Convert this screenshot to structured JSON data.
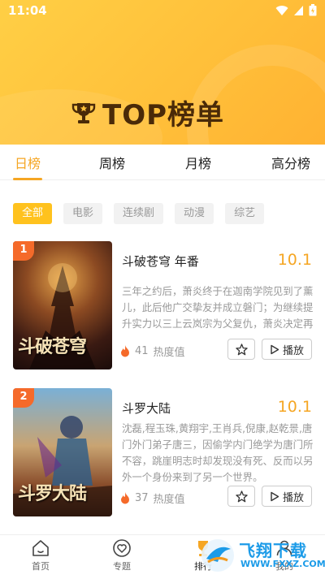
{
  "status": {
    "time": "11:04"
  },
  "header": {
    "title": "TOP榜单"
  },
  "tabs": [
    {
      "label": "日榜",
      "active": true
    },
    {
      "label": "周榜",
      "active": false
    },
    {
      "label": "月榜",
      "active": false
    },
    {
      "label": "高分榜",
      "active": false
    }
  ],
  "chips": [
    {
      "label": "全部",
      "active": true
    },
    {
      "label": "电影",
      "active": false
    },
    {
      "label": "连续剧",
      "active": false
    },
    {
      "label": "动漫",
      "active": false
    },
    {
      "label": "综艺",
      "active": false
    }
  ],
  "items": [
    {
      "rank": "1",
      "title": "斗破苍穹 年番",
      "score": "10.1",
      "desc": "三年之约后，萧炎终于在迦南学院见到了薰儿，此后他广交挚友并成立磐门；为继续提升实力以三上云岚宗为父复仇，萧炎决定再战。",
      "heat": "41",
      "heat_label": "热度值",
      "play_label": "播放",
      "poster_text": "斗破苍穹"
    },
    {
      "rank": "2",
      "title": "斗罗大陆",
      "score": "10.1",
      "desc": "沈磊,程玉珠,黄翔宇,王肖兵,倪康,赵乾景,唐门外门弟子唐三，因偷学内门绝学为唐门所不容，跳崖明志时却发现没有死、反而以另外一个身份来到了另一个世界。",
      "heat": "37",
      "heat_label": "热度值",
      "play_label": "播放",
      "poster_text": "斗罗大陆"
    }
  ],
  "bottom_nav": [
    {
      "label": "首页",
      "icon": "home-icon"
    },
    {
      "label": "专题",
      "icon": "heart-icon"
    },
    {
      "label": "排行",
      "icon": "trophy-icon"
    },
    {
      "label": "我的",
      "icon": "user-icon"
    }
  ],
  "watermark": {
    "line1": "飞翔下载",
    "line2": "WWW.FXXZ.COM"
  },
  "colors": {
    "accent": "#f5a623",
    "header": "#ffc03a",
    "rank_badge": "#f56a2a",
    "chip_active": "#ffc21e"
  }
}
